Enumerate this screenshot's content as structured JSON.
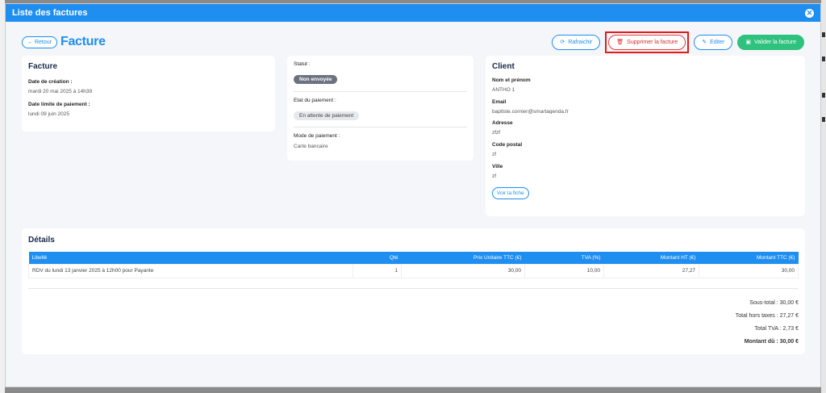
{
  "modal": {
    "title": "Liste des factures"
  },
  "header": {
    "back_label": "← Retour",
    "title": "Facture",
    "refresh_label": "Rafraichir",
    "delete_label": "Supprimer la facture",
    "edit_label": "Editer",
    "validate_label": "Valider la facture"
  },
  "invoice": {
    "heading": "Facture",
    "created_label": "Date de création :",
    "created_value": "mardi 20 mai 2025 à 14h39",
    "due_label": "Date limite de paiement :",
    "due_value": "lundi 09 juin 2025"
  },
  "status": {
    "status_label": "Statut :",
    "status_value": "Non envoyée",
    "payment_state_label": "Etat du paiement :",
    "payment_state_value": "En attente de paiement",
    "payment_method_label": "Mode de paiement :",
    "payment_method_value": "Carte bancaire"
  },
  "client": {
    "heading": "Client",
    "name_label": "Nom et prénom",
    "name_value": "ANTHO 1",
    "email_label": "Email",
    "email_value": "baptiste.cornier@smartagenda.fr",
    "address_label": "Adresse",
    "address_value": "zfzf",
    "postal_label": "Code postal",
    "postal_value": "zf",
    "city_label": "Ville",
    "city_value": "zf",
    "view_label": "Voir la fiche"
  },
  "details": {
    "heading": "Détails",
    "columns": [
      "Libellé",
      "Qté",
      "Prix Unitaire TTC (€)",
      "TVA (%)",
      "Montant HT (€)",
      "Montant TTC (€)"
    ],
    "rows": [
      [
        "RDV du lundi 13 janvier 2025 à 12h00 pour Payante",
        "1",
        "30,00",
        "10,00",
        "27,27",
        "30,00"
      ]
    ],
    "subtotal": "Sous-total : 30,00 €",
    "total_ht": "Total hors taxes : 27,27 €",
    "total_tva": "Total TVA : 2,73 €",
    "amount_due": "Montant dû : 30,00 €"
  },
  "colors": {
    "primary": "#1f8ef1",
    "danger": "#e21b1b",
    "success": "#2ec27e"
  }
}
